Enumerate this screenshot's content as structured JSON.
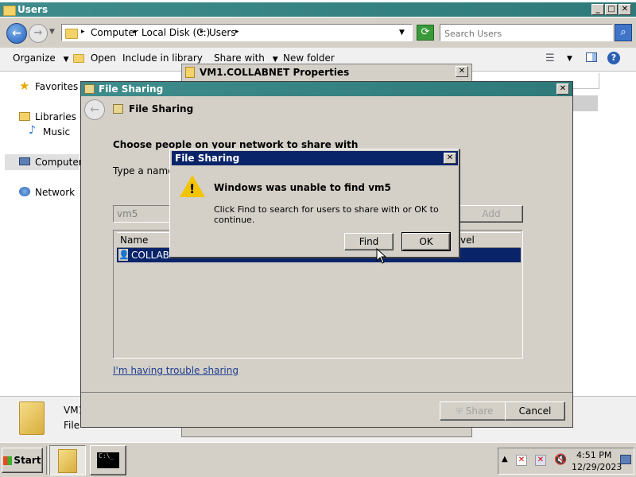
{
  "explorer": {
    "title": "Users",
    "breadcrumb": [
      "Computer",
      "Local Disk (C:)",
      "Users"
    ],
    "search_placeholder": "Search Users",
    "toolbar": {
      "organize": "Organize",
      "open": "Open",
      "include_in_library": "Include in library",
      "share_with": "Share with",
      "new_folder": "New folder"
    },
    "nav": {
      "favorites": "Favorites",
      "libraries": "Libraries",
      "music": "Music",
      "computer": "Computer",
      "network": "Network"
    },
    "details": {
      "name_partial": "VM1",
      "type_partial": "File"
    }
  },
  "properties_window": {
    "title": "VM1.COLLABNET Properties"
  },
  "file_sharing_window": {
    "title": "File Sharing",
    "header": "File Sharing",
    "heading": "Choose people on your network to share with",
    "type_label_partial": "Type a name",
    "input_value": "vm5",
    "add_button": "Add",
    "col_name": "Name",
    "col_level_partial": "vel",
    "row_name_partial": "COLLABN",
    "trouble_link": "I'm having trouble sharing",
    "share_button": "Share",
    "cancel_button": "Cancel"
  },
  "error_dialog": {
    "title": "File Sharing",
    "message_title": "Windows was unable to find vm5",
    "message_body": "Click Find to search for users to share with or OK to continue.",
    "find_button": "Find",
    "ok_button": "OK"
  },
  "taskbar": {
    "start": "Start",
    "time": "4:51 PM",
    "date": "12/29/2023"
  }
}
